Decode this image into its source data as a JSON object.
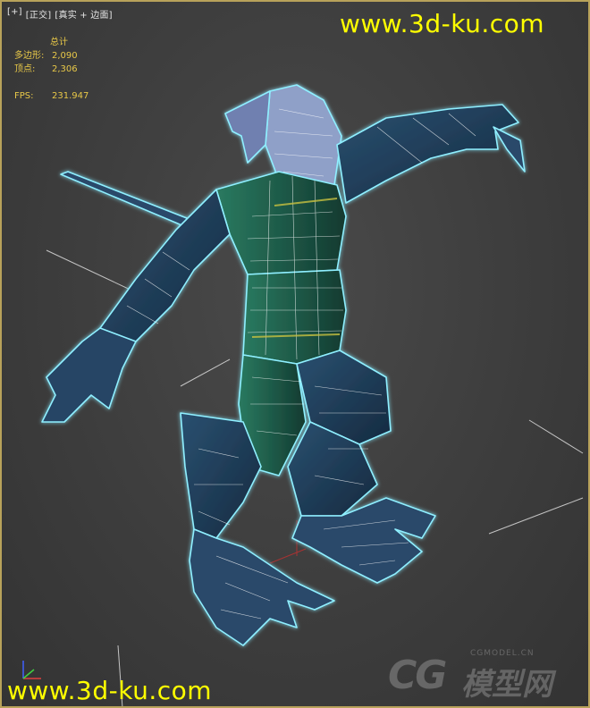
{
  "viewport": {
    "menu_plus": "[+]",
    "menu_view": "[正交]",
    "menu_shading": "[真实 + 边面]",
    "border_color": "#b8a25a",
    "background": "#3d3d3d"
  },
  "stats": {
    "title": "总计",
    "polys_label": "多边形:",
    "polys_value": "2,090",
    "verts_label": "顶点:",
    "verts_value": "2,306",
    "fps_label": "FPS:",
    "fps_value": "231.947",
    "color": "#e8c848"
  },
  "watermark": {
    "top_text": "www.3d-ku.com",
    "bottom_text": "www.3d-ku.com",
    "cg_small": "CGMODEL.CN",
    "cg_big": "CG",
    "cg_cn": "模型网",
    "color": "#ffff00"
  },
  "model": {
    "wire_color": "#ffffff",
    "glow_color": "#7fe8ff",
    "body_color": "#1f3a55",
    "armor_color": "#1d5a4a",
    "accent_color": "#c8c040",
    "selection_icon": "selection-bracket-icon"
  },
  "axis": {
    "x_color": "#e04040",
    "y_color": "#40d040",
    "z_color": "#4060ff"
  }
}
